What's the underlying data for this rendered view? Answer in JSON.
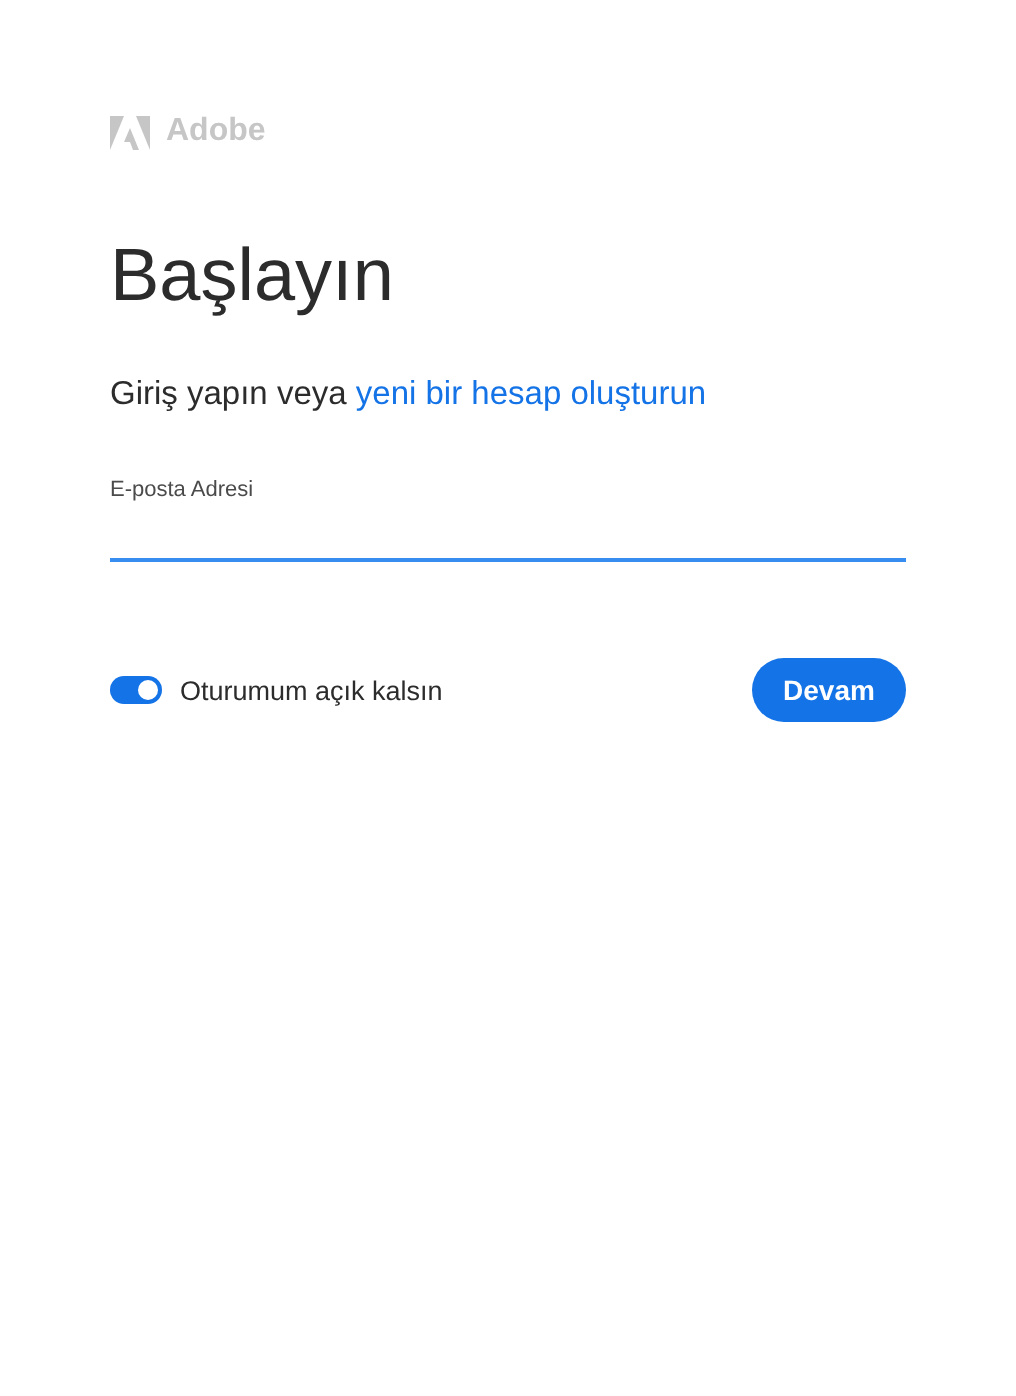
{
  "brand": {
    "name": "Adobe"
  },
  "heading": "Başlayın",
  "subtitle": {
    "text": "Giriş yapın veya ",
    "link": "yeni bir hesap oluşturun"
  },
  "email": {
    "label": "E-posta Adresi",
    "focused": true
  },
  "remember": {
    "label": "Oturumum açık kalsın",
    "on": true
  },
  "continue_button": "Devam"
}
